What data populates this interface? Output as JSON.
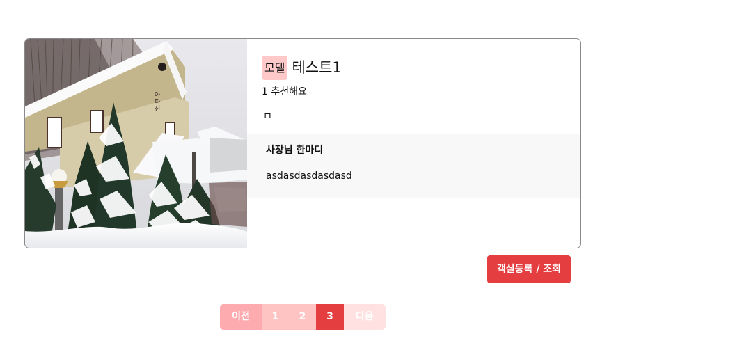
{
  "listing": {
    "category": "모텔",
    "name": "테스트1",
    "recommend_text": "1 추천해요",
    "small_text": "ㅁ",
    "owner_title": "사장님 한마디",
    "owner_message": "asdasdasdasdasd",
    "photo_description_icon": "house-snow-photo-icon"
  },
  "actions": {
    "room_button": "객실등록 / 조회"
  },
  "pagination": {
    "prev": "이전",
    "pages": [
      "1",
      "2",
      "3"
    ],
    "current": "3",
    "next": "다음"
  },
  "colors": {
    "primary": "#e53e40",
    "badge": "#ffc9c9",
    "pagination_prev": "#fdabae",
    "pagination_page": "#fec4c4",
    "pagination_next": "#ffe1e1",
    "owner_box": "#f8f8f8"
  }
}
